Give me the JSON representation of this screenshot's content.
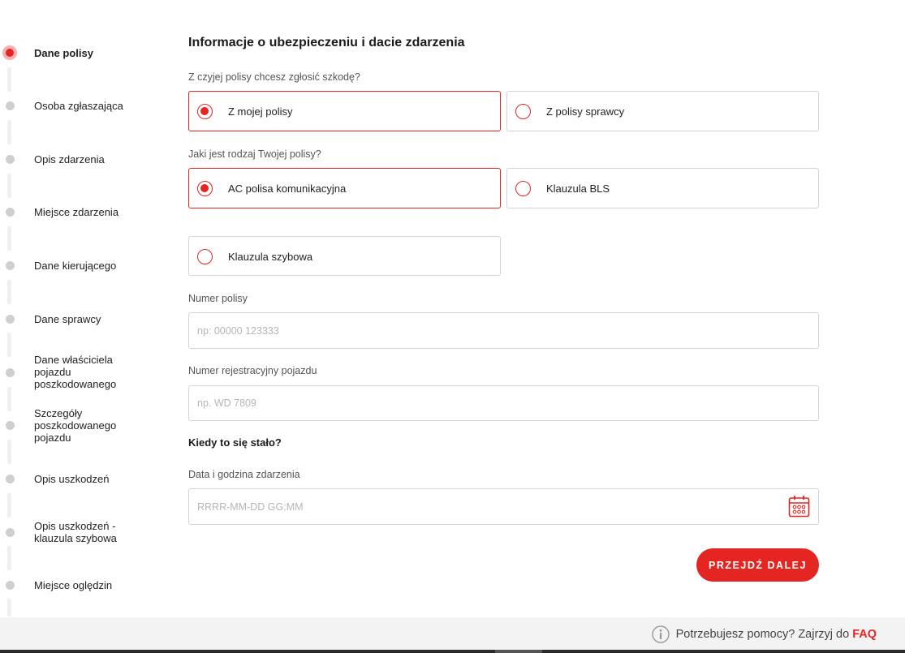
{
  "stepper": {
    "steps": [
      {
        "label": "Dane polisy",
        "active": true
      },
      {
        "label": "Osoba zgłaszająca",
        "active": false
      },
      {
        "label": "Opis zdarzenia",
        "active": false
      },
      {
        "label": "Miejsce zdarzenia",
        "active": false
      },
      {
        "label": "Dane kierującego",
        "active": false
      },
      {
        "label": "Dane sprawcy",
        "active": false
      },
      {
        "label": "Dane właściciela pojazdu poszkodowanego",
        "active": false
      },
      {
        "label": "Szczegóły poszkodowanego pojazdu",
        "active": false
      },
      {
        "label": "Opis uszkodzeń",
        "active": false
      },
      {
        "label": "Opis uszkodzeń - klauzula szybowa",
        "active": false
      },
      {
        "label": "Miejsce oględzin",
        "active": false
      }
    ]
  },
  "form": {
    "title": "Informacje o ubezpieczeniu i dacie zdarzenia",
    "q1": {
      "label": "Z czyjej polisy chcesz zgłosić szkodę?",
      "options": [
        {
          "label": "Z mojej polisy",
          "selected": true
        },
        {
          "label": "Z polisy sprawcy",
          "selected": false
        }
      ]
    },
    "q2": {
      "label": "Jaki jest rodzaj Twojej polisy?",
      "options": [
        {
          "label": "AC polisa komunikacyjna",
          "selected": true
        },
        {
          "label": "Klauzula BLS",
          "selected": false
        },
        {
          "label": "Klauzula szybowa",
          "selected": false
        }
      ]
    },
    "policy_number": {
      "label": "Numer polisy",
      "value": "",
      "placeholder": "np: 00000 123333"
    },
    "registration": {
      "label": "Numer rejestracyjny pojazdu",
      "value": "",
      "placeholder": "np. WD 7809"
    },
    "when_heading": "Kiedy to się stało?",
    "datetime": {
      "label": "Data i godzina zdarzenia",
      "value": "",
      "placeholder": "RRRR-MM-DD GG:MM",
      "icon": "calendar-icon"
    },
    "next_button": "PRZEJDŹ DALEJ"
  },
  "footer": {
    "help_text": "Potrzebujesz pomocy? Zajrzyj do",
    "faq_label": "FAQ",
    "icon": "info-icon"
  },
  "colors": {
    "accent": "#e52521",
    "inactive_dot": "#cfcfcf",
    "border": "#d4d4d4",
    "footer_bg": "#f3f3f3"
  }
}
